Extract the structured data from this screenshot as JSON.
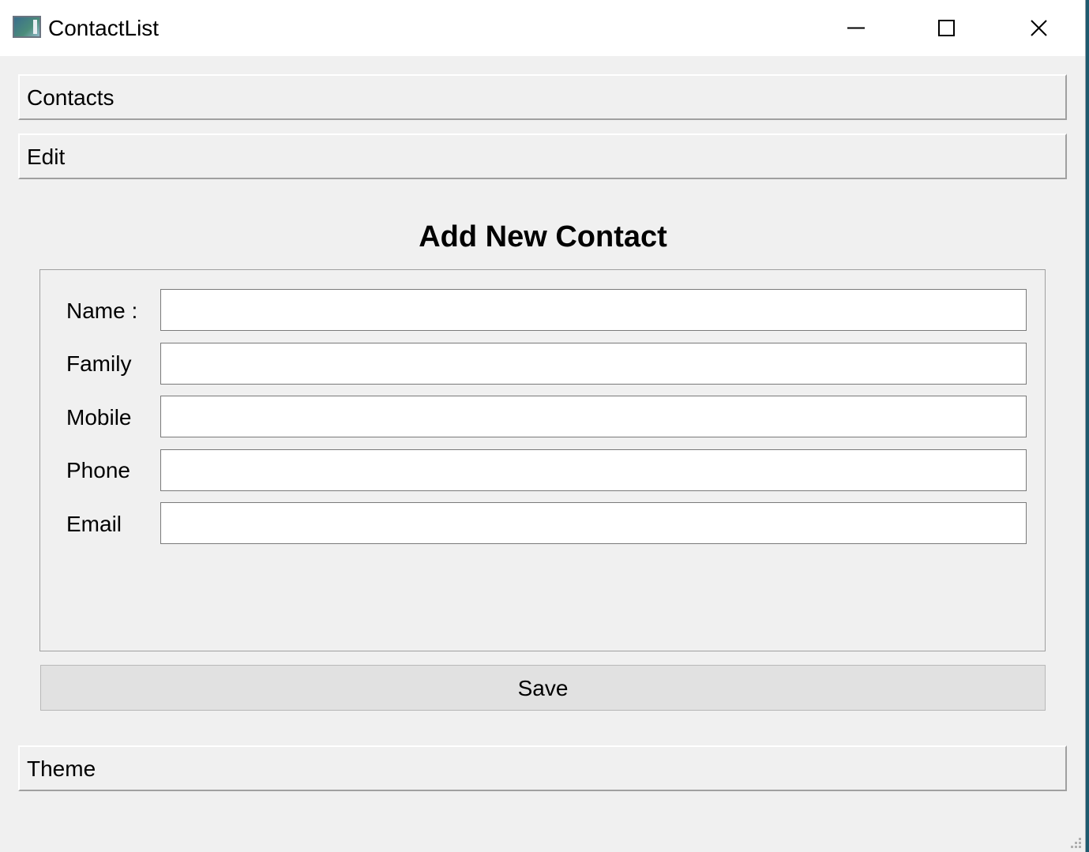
{
  "window": {
    "title": "ContactList"
  },
  "sections": {
    "contacts_label": "Contacts",
    "edit_label": "Edit",
    "theme_label": "Theme"
  },
  "form": {
    "title": "Add New Contact",
    "fields": [
      {
        "label": "Name :",
        "value": ""
      },
      {
        "label": "Family",
        "value": ""
      },
      {
        "label": "Mobile",
        "value": ""
      },
      {
        "label": "Phone",
        "value": ""
      },
      {
        "label": "Email",
        "value": ""
      }
    ],
    "save_label": "Save"
  },
  "icons": {
    "app": "app-window-icon",
    "minimize": "minimize-icon",
    "maximize": "maximize-icon",
    "close": "close-icon",
    "grip": "resize-grip-icon"
  },
  "colors": {
    "background": "#f0f0f0",
    "titlebar": "#ffffff",
    "button": "#e1e1e1"
  }
}
